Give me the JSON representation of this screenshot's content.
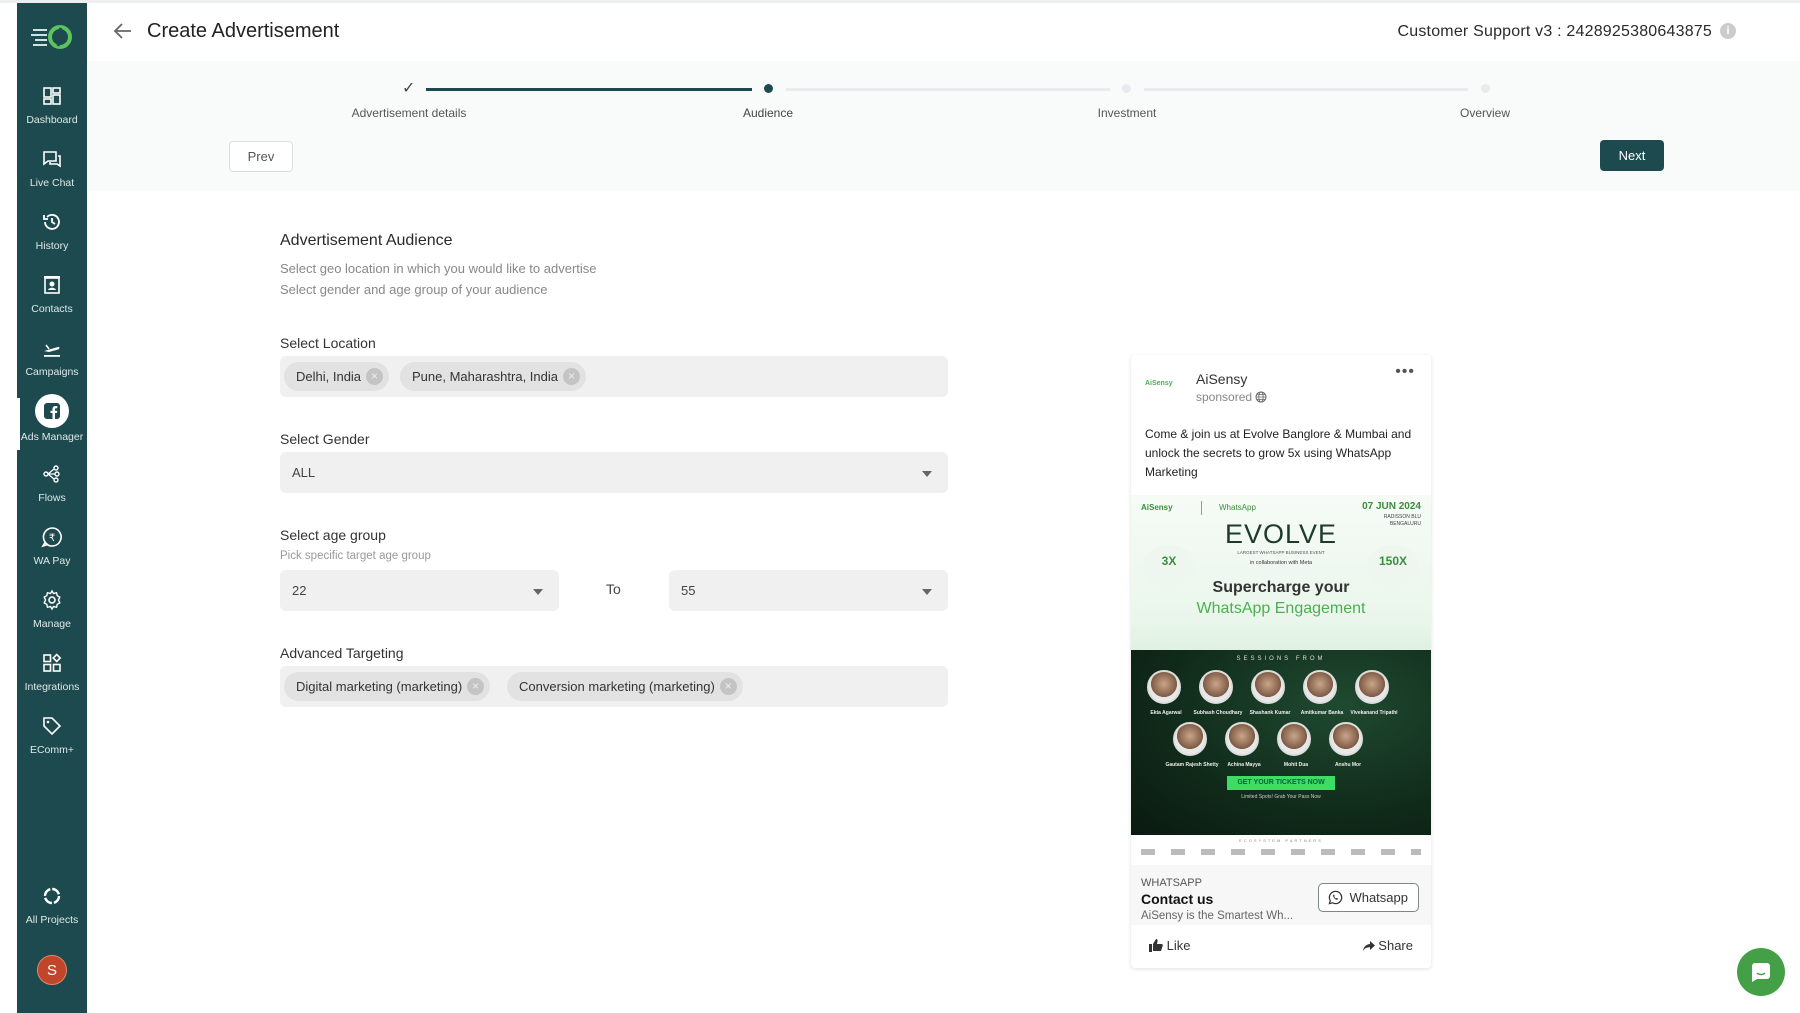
{
  "sidebar": {
    "items": [
      {
        "label": "Dashboard",
        "icon": "dashboard-icon"
      },
      {
        "label": "Live Chat",
        "icon": "chat-icon"
      },
      {
        "label": "History",
        "icon": "history-icon"
      },
      {
        "label": "Contacts",
        "icon": "contacts-icon"
      },
      {
        "label": "Campaigns",
        "icon": "campaigns-icon"
      },
      {
        "label": "Ads Manager",
        "icon": "facebook-icon",
        "active": true
      },
      {
        "label": "Flows",
        "icon": "flows-icon"
      },
      {
        "label": "WA Pay",
        "icon": "rupee-icon"
      },
      {
        "label": "Manage",
        "icon": "gear-icon"
      },
      {
        "label": "Integrations",
        "icon": "integrations-icon"
      },
      {
        "label": "EComm+",
        "icon": "tag-icon"
      }
    ],
    "all_projects": "All Projects",
    "avatar_initial": "S"
  },
  "header": {
    "title": "Create Advertisement",
    "project": "Customer Support v3 : 2428925380643875",
    "info_icon": "i"
  },
  "stepper": {
    "steps": [
      {
        "label": "Advertisement details",
        "state": "done"
      },
      {
        "label": "Audience",
        "state": "current"
      },
      {
        "label": "Investment",
        "state": "todo"
      },
      {
        "label": "Overview",
        "state": "todo"
      }
    ],
    "prev_label": "Prev",
    "next_label": "Next",
    "check_glyph": "✓"
  },
  "form": {
    "title": "Advertisement Audience",
    "subtitle_1": "Select geo location in which you would like to advertise",
    "subtitle_2": "Select gender and age group of your audience",
    "location": {
      "label": "Select Location",
      "chips": [
        "Delhi, India",
        "Pune, Maharashtra, India"
      ]
    },
    "gender": {
      "label": "Select Gender",
      "value": "ALL"
    },
    "age": {
      "label": "Select age group",
      "hint": "Pick specific target age group",
      "from": "22",
      "to_label": "To",
      "to": "55"
    },
    "targeting": {
      "label": "Advanced Targeting",
      "chips": [
        "Digital marketing (marketing)",
        "Conversion marketing (marketing)"
      ]
    },
    "chip_remove_glyph": "×"
  },
  "preview": {
    "logo_text": "AiSensy",
    "brand": "AiSensy",
    "sponsored": "sponsored",
    "more": "•••",
    "text": "Come & join us at Evolve Banglore & Mumbai and unlock the secrets to grow 5x using WhatsApp Marketing",
    "image": {
      "brand_left": "AiSensy",
      "brand_right": "WhatsApp",
      "date": "07 JUN 2024",
      "venue_1": "RADISSON BLU",
      "venue_2": "BENGALURU",
      "event": "EVOLVE",
      "event_sub": "LARGEST WHATSAPP BUSINESS EVENT",
      "collab": "in collaboration with Meta",
      "stat_left": "3X",
      "stat_right": "150X",
      "headline_1": "Supercharge your",
      "headline_2": "WhatsApp Engagement",
      "sessions": "SESSIONS FROM",
      "speakers": [
        "Ekta Agarwal",
        "Subhash Choudhary",
        "Shashank Kumar",
        "Amitkumar Banka",
        "Vivekanand Tripathi",
        "Gautam Rajesh Shetty",
        "Achina Mayya",
        "Mohit Dua",
        "Anshu Mor"
      ],
      "cta": "GET YOUR TICKETS NOW",
      "cta_sub": "Limited Spots! Grab Your Pass Now",
      "partners": "ECOSYSTEM PARTNERS"
    },
    "footer": {
      "kind": "WHATSAPP",
      "title": "Contact us",
      "desc": "AiSensy is the Smartest Wh...",
      "button": "Whatsapp"
    },
    "like": "Like",
    "share": "Share"
  },
  "colors": {
    "sidebar": "#1d4a4f",
    "accent": "#1d4a4f",
    "chat_bubble": "#43a047"
  }
}
